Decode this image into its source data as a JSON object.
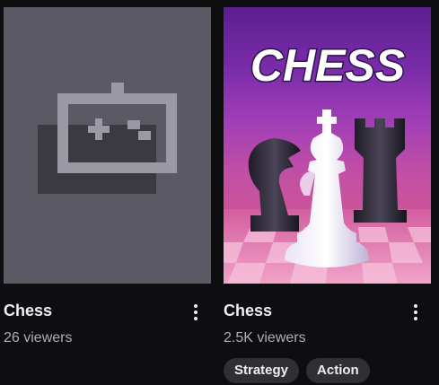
{
  "cards": [
    {
      "title": "Chess",
      "viewers": "26 viewers",
      "thumbnail": "controller-placeholder-icon",
      "tags": []
    },
    {
      "title": "Chess",
      "viewers": "2.5K viewers",
      "thumbnail": "chess-box-art",
      "art_title": "CHESS",
      "tags": [
        "Strategy",
        "Action"
      ]
    }
  ],
  "colors": {
    "background": "#0e0e10",
    "placeholder_bg": "#5b5964",
    "placeholder_icon": "#9b99a3",
    "text_primary": "#efeff1",
    "text_secondary": "#adadb8",
    "tag_bg": "#2f2f35"
  }
}
